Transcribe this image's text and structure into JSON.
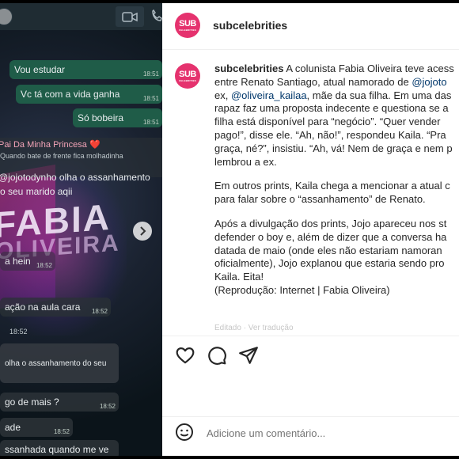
{
  "chat": {
    "messages": [
      {
        "text": "Vou estudar",
        "time": "18:51"
      },
      {
        "text": "Vc tá com a vida ganha",
        "time": "18:51"
      },
      {
        "text": "Só bobeira",
        "time": "18:51"
      }
    ],
    "reply_name": "Pai Da Minha Princesa ❤️",
    "reply_quote": "Quando bate de frente fica molhadinha",
    "reply_line1": "@jojotodynho olha o assanhamento",
    "reply_line2": "o seu marido aqii",
    "overlay_word1": "FABIA",
    "overlay_word2": "OLIVEIRA",
    "msg_hein": "a hein",
    "msg_hein_time": "18:52",
    "msg_aula": "ação na aula cara",
    "msg_aula_time": "18:52",
    "lone_time": "18:52",
    "msg_olha": "olha o assanhamento do seu",
    "msg_mais": "go de mais ?",
    "msg_mais_time": "18:52",
    "msg_dade": "ade",
    "msg_dade_time": "18:52",
    "msg_last": "ssanhada quando me ve"
  },
  "post": {
    "account": "subcelebrities",
    "logo_text": "SUB",
    "logo_subtext": "CELEBRITIES",
    "caption_lines_p1": [
      {
        "bold": "subcelebrities",
        "text": " A colunista Fabia Oliveira teve acess"
      },
      {
        "text": "entre Renato Santiago, atual namorado de ",
        "link": "@jojoto"
      },
      {
        "text_pre": "ex, ",
        "link": "@oliveira_kailaa",
        "text": ", mãe da sua filha. Em uma das"
      },
      {
        "text": "rapaz faz uma proposta indecente e questiona se a"
      },
      {
        "text": "filha está disponível para “negócio”. “Quer vender"
      },
      {
        "text": "pago!”, disse ele. “Ah, não!”, respondeu Kaila. “Pra"
      },
      {
        "text": "graça, né?”, insistiu. “Ah, vá! Nem de graça e nem p"
      },
      {
        "text": "lembrou a ex."
      }
    ],
    "caption_lines_p2": [
      "Em outros prints, Kaila chega a mencionar a atual c",
      "para falar sobre o “assanhamento” de Renato."
    ],
    "caption_lines_p3": [
      "Após a divulgação dos prints, Jojo apareceu nos st",
      "defender o boy e, além de dizer que a conversa ha",
      "datada de maio (onde eles não estariam namoran",
      "oficialmente), Jojo explanou que estaria sendo pro",
      "Kaila. Eita!",
      "(Reprodução: Internet | Fabia Oliveira)"
    ],
    "edited_note": "Editado · Ver tradução",
    "comment_placeholder": "Adicione um comentário..."
  },
  "icons": [
    "heart-icon",
    "comment-icon",
    "share-icon",
    "emoji-icon",
    "video-call-icon",
    "phone-icon",
    "chevron-right-icon"
  ],
  "colors": {
    "brand": "#e5326e",
    "wa_out": "#1f5c48",
    "link": "#00376b"
  }
}
